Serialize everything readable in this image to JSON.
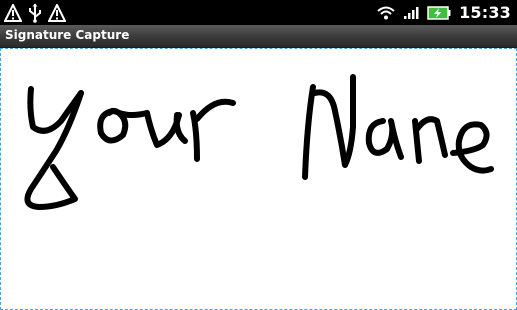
{
  "status_bar": {
    "time": "15:33",
    "notification_icons": [
      "warning-icon",
      "usb-icon",
      "warning-icon"
    ],
    "system_icons": [
      "wifi-icon",
      "signal-icon",
      "battery-charging-icon"
    ],
    "colors": {
      "background": "#000000",
      "text": "#ffffff",
      "battery": "#3fbf3f"
    }
  },
  "app": {
    "title": "Signature Capture"
  },
  "signature_pad": {
    "signature_text": "Your Name",
    "border_color": "#4aa3d8",
    "ink_color": "#000000",
    "background": "#ffffff"
  }
}
